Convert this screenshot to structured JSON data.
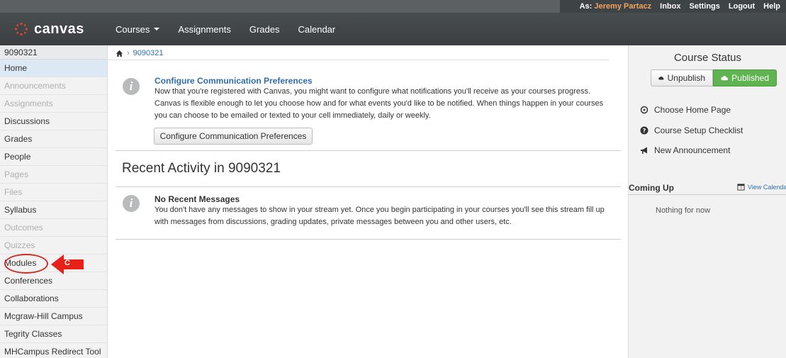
{
  "topbar": {
    "as_prefix": "As:",
    "user_name": "Jeremy Partacz",
    "inbox": "Inbox",
    "settings": "Settings",
    "logout": "Logout",
    "help": "Help"
  },
  "brand": {
    "name": "canvas"
  },
  "nav": {
    "courses": "Courses",
    "assignments": "Assignments",
    "grades": "Grades",
    "calendar": "Calendar"
  },
  "sidebar": {
    "course_code": "9090321",
    "items": [
      {
        "label": "Home",
        "state": "active"
      },
      {
        "label": "Announcements",
        "state": "disabled"
      },
      {
        "label": "Assignments",
        "state": "disabled"
      },
      {
        "label": "Discussions",
        "state": "enabled"
      },
      {
        "label": "Grades",
        "state": "enabled"
      },
      {
        "label": "People",
        "state": "enabled"
      },
      {
        "label": "Pages",
        "state": "disabled"
      },
      {
        "label": "Files",
        "state": "disabled"
      },
      {
        "label": "Syllabus",
        "state": "enabled"
      },
      {
        "label": "Outcomes",
        "state": "disabled"
      },
      {
        "label": "Quizzes",
        "state": "disabled"
      },
      {
        "label": "Modules",
        "state": "enabled"
      },
      {
        "label": "Conferences",
        "state": "enabled"
      },
      {
        "label": "Collaborations",
        "state": "enabled"
      },
      {
        "label": "Mcgraw-Hill Campus",
        "state": "enabled"
      },
      {
        "label": "Tegrity Classes",
        "state": "enabled"
      },
      {
        "label": "MHCampus Redirect Tool",
        "state": "enabled"
      }
    ]
  },
  "annotation": {
    "marker": "C"
  },
  "breadcrumb": {
    "course": "9090321"
  },
  "messages": {
    "config_title": "Configure Communication Preferences",
    "config_body": "Now that you're registered with Canvas, you might want to configure what notifications you'll receive as your courses progress. Canvas is flexible enough to let you choose how and for what events you'd like to be notified. When things happen in your courses you can choose to be emailed or texted to your cell immediately, daily or weekly.",
    "config_button": "Configure Communication Preferences",
    "recent_heading": "Recent Activity in 9090321",
    "no_recent_title": "No Recent Messages",
    "no_recent_body": "You don't have any messages to show in your stream yet. Once you begin participating in your courses you'll see this stream fill up with messages from discussions, grading updates, private messages between you and other users, etc."
  },
  "right_panel": {
    "status_title": "Course Status",
    "unpublish": "Unpublish",
    "published": "Published",
    "choose_home": "Choose Home Page",
    "setup_checklist": "Course Setup Checklist",
    "new_announcement": "New Announcement",
    "coming_up": "Coming Up",
    "view_calendar": "View Calenda",
    "nothing": "Nothing for now"
  },
  "colors": {
    "link": "#2f6eac",
    "published_green": "#5fb350",
    "user_name_orange": "#f2a35c",
    "annotation_red": "#e8201a"
  }
}
